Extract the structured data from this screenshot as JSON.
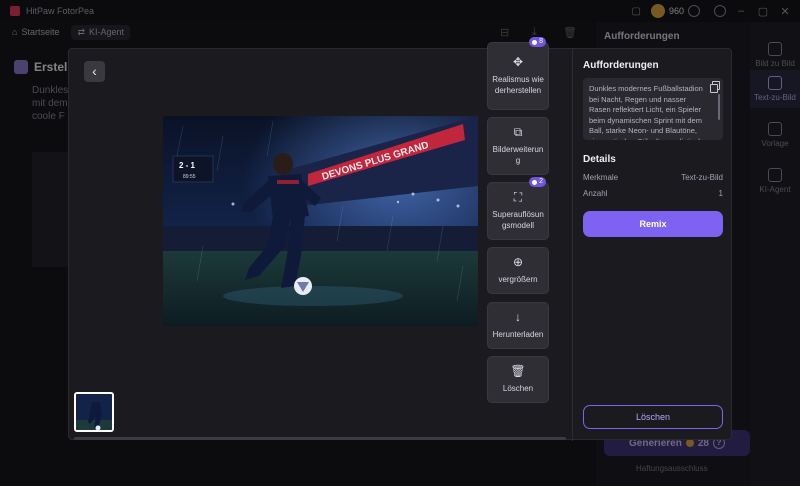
{
  "app": {
    "title": "HitPaw FotorPea",
    "coins": "960"
  },
  "nav": {
    "home": "Startseite",
    "agent": "KI-Agent"
  },
  "background": {
    "card_title": "Erstellu",
    "card_text": "Dunkles mit dem coole F",
    "panel_title": "Aufforderungen",
    "generate_label": "Generieren",
    "generate_cost": "28",
    "disclaimer": "Haftungsausschluss"
  },
  "far_sidebar": {
    "items": [
      {
        "label": "Bild zu Bild",
        "icon": "image-icon"
      },
      {
        "label": "Text-zu-Bild",
        "icon": "text-image-icon"
      },
      {
        "label": "Vorlage",
        "icon": "template-icon"
      },
      {
        "label": "KI-Agent",
        "icon": "agent-icon"
      }
    ]
  },
  "modal": {
    "tools": [
      {
        "label": "Realismus wiederherstellen",
        "icon": "realism-icon",
        "badge": "8"
      },
      {
        "label": "Bilderweiterung",
        "icon": "expand-image-icon",
        "badge": ""
      },
      {
        "label": "Superauflösungsmodell",
        "icon": "super-resolution-icon",
        "badge": "2"
      },
      {
        "label": "vergrößern",
        "icon": "zoom-in-icon",
        "badge": ""
      },
      {
        "label": "Herunterladen",
        "icon": "download-icon",
        "badge": ""
      },
      {
        "label": "Löschen",
        "icon": "trash-icon",
        "badge": ""
      }
    ],
    "image_text": {
      "banner": "DEVONS PLUS GRAND",
      "score": "2 - 1",
      "clock": "89:55"
    },
    "side": {
      "title": "Aufforderungen",
      "prompt": "Dunkles modernes Fußballstadion bei Nacht, Regen und nasser Rasen reflektiert Licht, ein Spieler beim dynamischen Sprint mit dem Ball, starke Neon- und Blautöne, cinematischer Stil, ultra-realistisch",
      "details_title": "Details",
      "details": [
        {
          "key": "Merkmale",
          "value": "Text-zu-Bild"
        },
        {
          "key": "Anzahl",
          "value": "1"
        }
      ],
      "remix_label": "Remix",
      "delete_label": "Löschen"
    }
  },
  "colors": {
    "accent": "#7e62f2",
    "badge": "#6f55e0"
  }
}
